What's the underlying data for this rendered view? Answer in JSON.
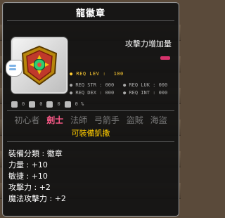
{
  "tooltip": {
    "title": "龍徽章",
    "attack_increase_label": "攻擊力增加量",
    "req": {
      "lev_label": "● REQ LEV :",
      "lev_value": "100",
      "str": "● REQ STR : 000",
      "luk": "● REQ LUK : 000",
      "dex": "● REQ DEX : 000",
      "int": "● REQ INT : 000"
    },
    "stat_values": [
      "0",
      "0",
      "0",
      "0 %"
    ],
    "jobs": [
      {
        "label": "初心者",
        "active": false
      },
      {
        "label": "劍士",
        "active": true
      },
      {
        "label": "法師",
        "active": false
      },
      {
        "label": "弓箭手",
        "active": false
      },
      {
        "label": "盜賊",
        "active": false
      },
      {
        "label": "海盜",
        "active": false
      }
    ],
    "equip_note": "可裝備凱撒",
    "stats": [
      "裝備分類 : 徽章",
      "力量 : +10",
      "敏捷 : +10",
      "攻擊力 : +2",
      "魔法攻擊力 : +2"
    ]
  },
  "colors": {
    "active_job": "#ff5a8a",
    "equip_note": "#ffcc00",
    "req_lev": "#ffcc33"
  },
  "icons": [
    "dragon-emblem-icon",
    "pointer-hand-icon"
  ]
}
